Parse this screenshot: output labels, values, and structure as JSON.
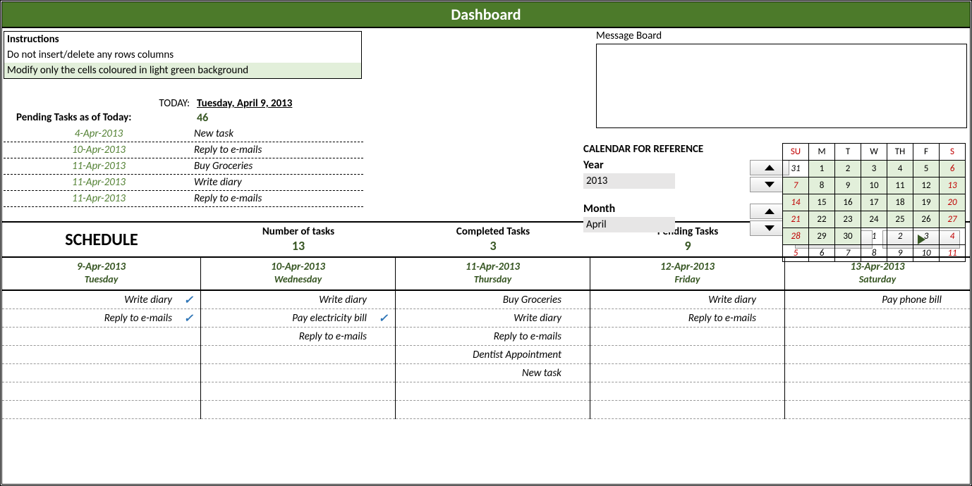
{
  "title": "Dashboard",
  "instructions": {
    "header": "Instructions",
    "line1": "Do not insert/delete any rows columns",
    "line2": "Modify only the cells coloured in light green background"
  },
  "message_board_label": "Message Board",
  "today_label": "TODAY:",
  "today_value": "Tuesday, April 9, 2013",
  "pending_label": "Pending Tasks as of Today:",
  "pending_count": "46",
  "pending_tasks": [
    {
      "date": "4-Apr-2013",
      "task": "New task"
    },
    {
      "date": "10-Apr-2013",
      "task": "Reply to e-mails"
    },
    {
      "date": "11-Apr-2013",
      "task": "Buy Groceries"
    },
    {
      "date": "11-Apr-2013",
      "task": "Write diary"
    },
    {
      "date": "11-Apr-2013",
      "task": "Reply to e-mails"
    }
  ],
  "calendar_ref_label": "CALENDAR FOR REFERENCE",
  "year_label": "Year",
  "year_value": "2013",
  "month_label": "Month",
  "month_value": "April",
  "mini_cal": {
    "headers": [
      "SU",
      "M",
      "T",
      "W",
      "TH",
      "F",
      "S"
    ],
    "rows": [
      [
        {
          "v": "31",
          "om": true,
          "wd": false
        },
        {
          "v": "1",
          "cm": true
        },
        {
          "v": "2",
          "cm": true
        },
        {
          "v": "3",
          "cm": true
        },
        {
          "v": "4",
          "cm": true
        },
        {
          "v": "5",
          "cm": true
        },
        {
          "v": "6",
          "cm": true,
          "wd": true
        }
      ],
      [
        {
          "v": "7",
          "cm": true,
          "wd": true
        },
        {
          "v": "8",
          "cm": true
        },
        {
          "v": "9",
          "cm": true
        },
        {
          "v": "10",
          "cm": true
        },
        {
          "v": "11",
          "cm": true
        },
        {
          "v": "12",
          "cm": true
        },
        {
          "v": "13",
          "cm": true,
          "wd": true
        }
      ],
      [
        {
          "v": "14",
          "cm": true,
          "wd": true
        },
        {
          "v": "15",
          "cm": true
        },
        {
          "v": "16",
          "cm": true
        },
        {
          "v": "17",
          "cm": true
        },
        {
          "v": "18",
          "cm": true
        },
        {
          "v": "19",
          "cm": true
        },
        {
          "v": "20",
          "cm": true,
          "wd": true
        }
      ],
      [
        {
          "v": "21",
          "cm": true,
          "wd": true
        },
        {
          "v": "22",
          "cm": true
        },
        {
          "v": "23",
          "cm": true
        },
        {
          "v": "24",
          "cm": true
        },
        {
          "v": "25",
          "cm": true
        },
        {
          "v": "26",
          "cm": true
        },
        {
          "v": "27",
          "cm": true,
          "wd": true
        }
      ],
      [
        {
          "v": "28",
          "cm": true,
          "wd": true
        },
        {
          "v": "29",
          "cm": true
        },
        {
          "v": "30",
          "cm": true
        },
        {
          "v": "1",
          "om": true
        },
        {
          "v": "2",
          "om": true
        },
        {
          "v": "3",
          "om": true
        },
        {
          "v": "4",
          "om": true,
          "wd": true
        }
      ],
      [
        {
          "v": "5",
          "om": true,
          "wd": true
        },
        {
          "v": "6",
          "om": true
        },
        {
          "v": "7",
          "om": true
        },
        {
          "v": "8",
          "om": true
        },
        {
          "v": "9",
          "om": true
        },
        {
          "v": "10",
          "om": true
        },
        {
          "v": "11",
          "om": true,
          "wd": true
        }
      ]
    ]
  },
  "stats": {
    "schedule_label": "SCHEDULE",
    "num_tasks_label": "Number of tasks",
    "num_tasks_value": "13",
    "completed_label": "Completed Tasks",
    "completed_value": "3",
    "pending_label": "Pending Tasks",
    "pending_value": "9"
  },
  "schedule": [
    {
      "date": "9-Apr-2013",
      "day": "Tuesday",
      "tasks": [
        {
          "t": "Write diary",
          "done": true
        },
        {
          "t": "Reply to e-mails",
          "done": true
        },
        {
          "t": ""
        },
        {
          "t": ""
        },
        {
          "t": ""
        },
        {
          "t": ""
        },
        {
          "t": ""
        }
      ]
    },
    {
      "date": "10-Apr-2013",
      "day": "Wednesday",
      "tasks": [
        {
          "t": "Write diary"
        },
        {
          "t": "Pay electricity bill",
          "done": true
        },
        {
          "t": "Reply to e-mails"
        },
        {
          "t": ""
        },
        {
          "t": ""
        },
        {
          "t": ""
        },
        {
          "t": ""
        }
      ]
    },
    {
      "date": "11-Apr-2013",
      "day": "Thursday",
      "tasks": [
        {
          "t": "Buy Groceries"
        },
        {
          "t": "Write diary"
        },
        {
          "t": "Reply to e-mails"
        },
        {
          "t": "Dentist Appointment"
        },
        {
          "t": "New task"
        },
        {
          "t": ""
        },
        {
          "t": ""
        }
      ]
    },
    {
      "date": "12-Apr-2013",
      "day": "Friday",
      "tasks": [
        {
          "t": "Write diary"
        },
        {
          "t": "Reply to e-mails"
        },
        {
          "t": ""
        },
        {
          "t": ""
        },
        {
          "t": ""
        },
        {
          "t": ""
        },
        {
          "t": ""
        }
      ]
    },
    {
      "date": "13-Apr-2013",
      "day": "Saturday",
      "tasks": [
        {
          "t": "Pay phone bill"
        },
        {
          "t": ""
        },
        {
          "t": ""
        },
        {
          "t": ""
        },
        {
          "t": ""
        },
        {
          "t": ""
        },
        {
          "t": ""
        }
      ]
    }
  ]
}
